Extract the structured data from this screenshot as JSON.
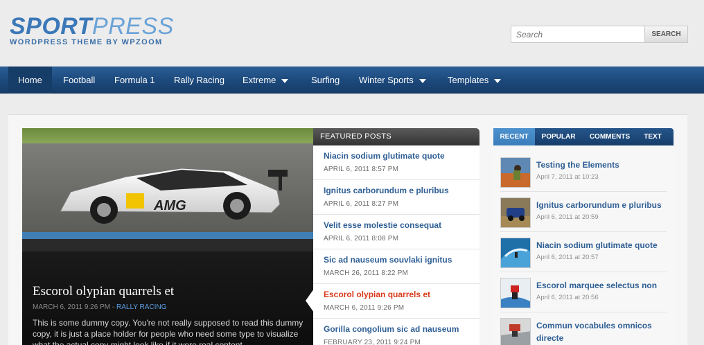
{
  "header": {
    "logo_bold": "SPORT",
    "logo_light": "PRESS",
    "tagline": "WORDPRESS THEME BY WPZOOM",
    "search_placeholder": "Search",
    "search_button": "SEARCH"
  },
  "nav": {
    "items": [
      {
        "label": "Home"
      },
      {
        "label": "Football"
      },
      {
        "label": "Formula 1"
      },
      {
        "label": "Rally Racing"
      },
      {
        "label": "Extreme"
      },
      {
        "label": "Surfing"
      },
      {
        "label": "Winter Sports"
      },
      {
        "label": "Templates"
      }
    ]
  },
  "slider": {
    "title": "Escorol olypian quarrels et",
    "date": "MARCH 6, 2011 9:26 PM",
    "sep": " - ",
    "category": "RALLY RACING",
    "excerpt": "This is some dummy copy. You're not really supposed to read this dummy copy, it is just a place holder for people who need some type to visualize what the actual copy might look like if it were real content."
  },
  "featured": {
    "header": "FEATURED POSTS",
    "items": [
      {
        "title": "Niacin sodium glutimate quote",
        "date": "APRIL 6, 2011 8:57 PM"
      },
      {
        "title": "Ignitus carborundum e pluribus",
        "date": "APRIL 6, 2011 8:27 PM"
      },
      {
        "title": "Velit esse molestie consequat",
        "date": "APRIL 6, 2011 8:08 PM"
      },
      {
        "title": "Sic ad nauseum souvlaki ignitus",
        "date": "MARCH 26, 2011 8:22 PM"
      },
      {
        "title": "Escorol olypian quarrels et",
        "date": "MARCH 6, 2011 9:26 PM"
      },
      {
        "title": "Gorilla congolium sic ad nauseum",
        "date": "FEBRUARY 23, 2011 9:24 PM"
      }
    ]
  },
  "sidebar": {
    "tabs": [
      {
        "label": "RECENT"
      },
      {
        "label": "POPULAR"
      },
      {
        "label": "COMMENTS"
      },
      {
        "label": "TEXT"
      }
    ],
    "items": [
      {
        "title": "Testing the Elements",
        "date": "April 7, 2011 at 10:23"
      },
      {
        "title": "Ignitus carborundum e pluribus",
        "date": "April 6, 2011 at 20:59"
      },
      {
        "title": "Niacin sodium glutimate quote",
        "date": "April 6, 2011 at 20:57"
      },
      {
        "title": "Escorol marquee selectus non",
        "date": "April 6, 2011 at 20:56"
      },
      {
        "title": "Commun vocabules omnicos directe",
        "date": ""
      }
    ]
  },
  "colors": {
    "brand": "#3b78b8",
    "nav": "#1d4a7d",
    "link": "#2f5f95",
    "active_link": "#d83a1a"
  }
}
